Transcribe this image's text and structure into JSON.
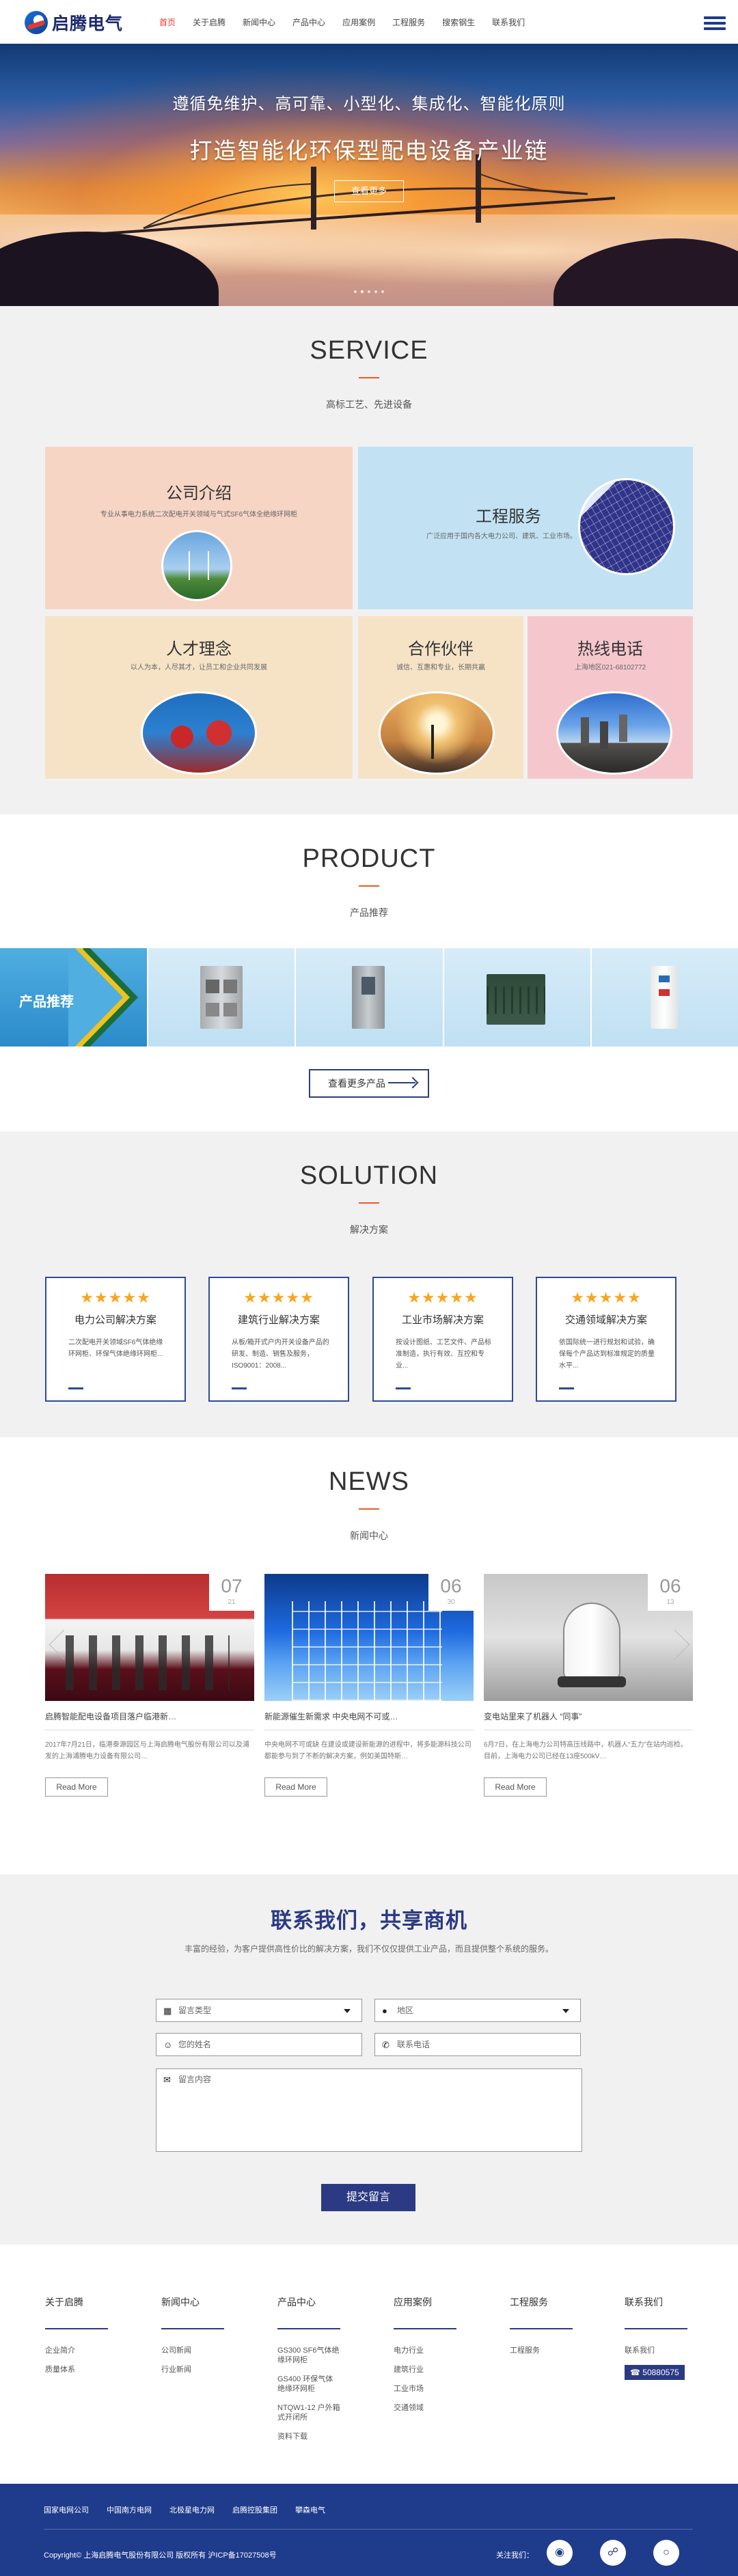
{
  "header": {
    "logo_text": "启腾电气",
    "nav": [
      "首页",
      "关于启腾",
      "新闻中心",
      "产品中心",
      "应用案例",
      "工程服务",
      "搜索钢生",
      "联系我们"
    ],
    "active_index": 0,
    "accent": "#e8382b"
  },
  "banner": {
    "line1": "遵循免维护、高可靠、小型化、集成化、智能化原则",
    "line2": "打造智能化环保型配电设备产业链",
    "button": "查看更多",
    "dots_active": 1
  },
  "service": {
    "title": "SERVICE",
    "subtitle": "高标工艺、先进设备",
    "cards": [
      {
        "title": "公司介绍",
        "desc": "专业从事电力系统二次配电开关领域与气式SF6气体全绝缘环网柜",
        "bg": "#f7d5c4",
        "photo": "wind-turbine"
      },
      {
        "title": "工程服务",
        "desc": "广泛应用于国内各大电力公司、建筑、工业市场。",
        "bg": "#c2e2f4",
        "photo": "solar-panel"
      },
      {
        "title": "人才理念",
        "desc": "以人为本，人尽其才，让员工和企业共同发展",
        "bg": "#f6e3c6",
        "photo": "workers"
      },
      {
        "title": "合作伙伴",
        "desc": "诚信、互惠和专业，长期共赢",
        "bg": "#f6e3c6",
        "photo": "surveyor"
      },
      {
        "title": "热线电话",
        "desc": "上海地区021-68102772",
        "bg": "#f5c7cd",
        "photo": "city"
      }
    ]
  },
  "product": {
    "title": "PRODUCT",
    "subtitle": "产品推荐",
    "label": "产品推荐",
    "items": [
      "switchgear-cabinet",
      "control-cabinet",
      "box-substation",
      "ring-main-unit"
    ],
    "more_button": "查看更多产品"
  },
  "solution": {
    "title": "SOLUTION",
    "subtitle": "解决方案",
    "stars": "★★★★★",
    "cards": [
      {
        "title": "电力公司解决方案",
        "desc": "二次配电开关领域SF6气体绝缘环网柜、环保气体绝缘环网柜..."
      },
      {
        "title": "建筑行业解决方案",
        "desc": "从板/箱开式户内开关设备产品的研发、制造、销售及服务，ISO9001：2008..."
      },
      {
        "title": "工业市场解决方案",
        "desc": "按设计图纸、工艺文件、产品标准制造，执行有效、互控和专业..."
      },
      {
        "title": "交通领域解决方案",
        "desc": "依国际统一进行规划和试验，确保每个产品达到标准规定的质量水平..."
      }
    ]
  },
  "news": {
    "title": "NEWS",
    "subtitle": "新闻中心",
    "items": [
      {
        "day": "07",
        "month": "21",
        "title": "启腾智能配电设备项目落户临港新…",
        "desc": "2017年7月21日，临港泰源园区与上海启腾电气股份有限公司以及浦发的上海浦腾电力设备有限公司…",
        "read": "Read More"
      },
      {
        "day": "06",
        "month": "30",
        "title": "新能源催生新需求 中央电网不可或…",
        "desc": "中央电网不可或缺 在建设或建设新能源的进程中，将多能源科技公司都能参与到了不断的解决方案，例如美国特斯…",
        "read": "Read More"
      },
      {
        "day": "06",
        "month": "13",
        "title": "变电站里来了机器人 “同事”",
        "desc": "6月7日，在上海电力公司特高压线路中，机器人“五力”在站内巡检。目前，上海电力公司已经在13座500kV…",
        "read": "Read More"
      }
    ]
  },
  "contact": {
    "title": "联系我们，共享商机",
    "subtitle": "丰富的经验，为客户提供高性价比的解决方案，我们不仅仅提供工业产品，而且提供整个系统的服务。",
    "type_placeholder": "留言类型",
    "region_placeholder": "地区",
    "name_placeholder": "您的姓名",
    "phone_placeholder": "联系电话",
    "message_placeholder": "留言内容",
    "submit": "提交留言"
  },
  "footer": {
    "columns": [
      {
        "title": "关于启腾",
        "items": [
          "企业简介",
          "质量体系"
        ]
      },
      {
        "title": "新闻中心",
        "items": [
          "公司新闻",
          "行业新闻"
        ]
      },
      {
        "title": "产品中心",
        "items": [
          "GS300 SF6气体绝缘环网柜",
          "GS400 环保气体绝缘环网柜",
          "NTQW1-12 户外箱式开闭所",
          "资料下载"
        ]
      },
      {
        "title": "应用案例",
        "items": [
          "电力行业",
          "建筑行业",
          "工业市场",
          "交通领域"
        ]
      },
      {
        "title": "工程服务",
        "items": [
          "工程服务"
        ]
      },
      {
        "title": "联系我们",
        "items": [
          "联系我们"
        ],
        "phone": "50880575"
      }
    ],
    "links": [
      "国家电网公司",
      "中国南方电网",
      "北极星电力网",
      "启腾控股集团",
      "攀森电气"
    ],
    "copyright": "Copyright© 上海启腾电气股份有限公司 版权所有 沪ICP备17027508号",
    "follow": "关注我们："
  },
  "colors": {
    "brand": "#2b3a83",
    "accent": "#e85d22",
    "stars": "#f5a623",
    "footer_bg": "#1f3b8c"
  }
}
